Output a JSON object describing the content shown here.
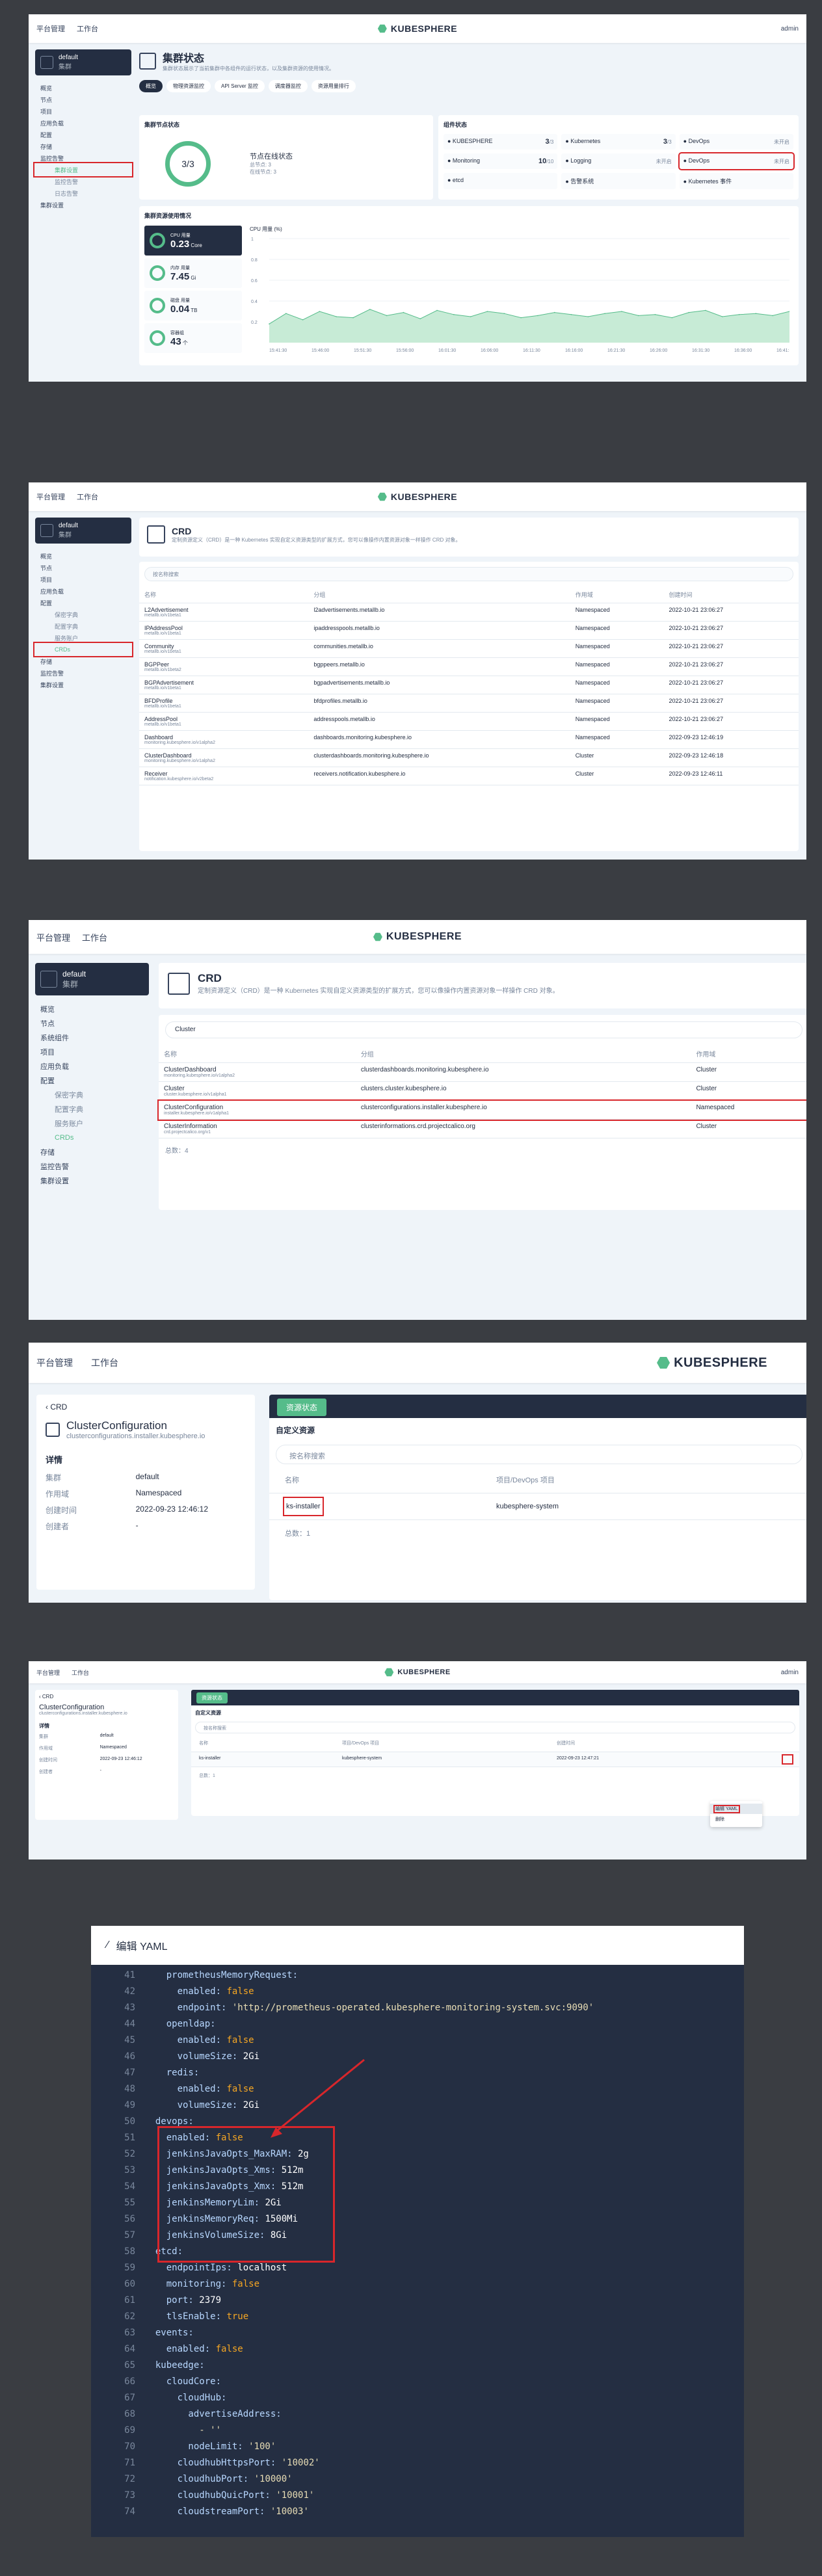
{
  "common": {
    "platform": "平台管理",
    "workbench": "工作台",
    "logo_text": "KUBESPHERE",
    "user": "admin",
    "workspace_name": "default",
    "workspace_sub": "集群"
  },
  "nav1": [
    "概览",
    "节点",
    "项目",
    "应用负载",
    "配置",
    "存储",
    "监控告警",
    "集群设置"
  ],
  "nav1_sub": [
    "集群设置",
    "监控告警",
    "日志告警"
  ],
  "s1": {
    "title": "集群状态",
    "desc": "集群状态展示了当前集群中各组件的运行状态，以及集群资源的使用情况。",
    "tabs": [
      "概览",
      "物理资源监控",
      "API Server 监控",
      "调度器监控",
      "资源用量排行"
    ],
    "node_card_title": "集群节点状态",
    "node_ring": "3/3",
    "node_status": "节点在线状态",
    "node_line1": "总节点: 3",
    "node_line2": "在线节点: 3",
    "comp_title": "组件状态",
    "components": [
      {
        "name": "KUBESPHERE",
        "count": "3",
        "unit": "/3"
      },
      {
        "name": "Kubernetes",
        "count": "3",
        "unit": "/3"
      },
      {
        "name": "DevOps",
        "count": "",
        "unit": "未开启"
      },
      {
        "name": "Monitoring",
        "count": "10",
        "unit": "/10"
      },
      {
        "name": "Logging",
        "count": "",
        "unit": "未开启"
      },
      {
        "name": "DevOps",
        "count": "",
        "unit": "未开启"
      },
      {
        "name": "etcd",
        "count": "",
        "unit": ""
      },
      {
        "name": "告警系统",
        "count": "",
        "unit": ""
      },
      {
        "name": "Kubernetes 事件",
        "count": "",
        "unit": ""
      }
    ],
    "res_title": "集群资源使用情况",
    "metrics": [
      {
        "label": "CPU 用量",
        "value": "0.23",
        "unit": "Core"
      },
      {
        "label": "内存 用量",
        "value": "7.45",
        "unit": "Gi"
      },
      {
        "label": "磁盘 用量",
        "value": "0.04",
        "unit": "TB"
      },
      {
        "label": "容器组",
        "value": "43",
        "unit": "个"
      }
    ],
    "chart_label": "CPU 用量 (%)",
    "chart_times": [
      "15:41:30",
      "15:46:00",
      "15:51:30",
      "15:56:00",
      "16:01:30",
      "16:06:00",
      "16:11:30",
      "16:16:00",
      "16:21:30",
      "16:26:00",
      "16:31:30",
      "16:36:00",
      "16:41:30"
    ]
  },
  "chart_data": {
    "type": "area",
    "title": "CPU 用量 (%)",
    "yticks": [
      "1",
      "0.8",
      "0.6",
      "0.4",
      "0.2"
    ],
    "ylim": [
      0,
      1
    ],
    "values": [
      0.18,
      0.28,
      0.22,
      0.3,
      0.25,
      0.24,
      0.32,
      0.26,
      0.29,
      0.23,
      0.31,
      0.27,
      0.25,
      0.3,
      0.28,
      0.24,
      0.26,
      0.29,
      0.27,
      0.25,
      0.28,
      0.3,
      0.26,
      0.27,
      0.24,
      0.29,
      0.31,
      0.25,
      0.27,
      0.28,
      0.26,
      0.3
    ]
  },
  "s2": {
    "title": "CRD",
    "desc": "定制资源定义（CRD）是一种 Kubernetes 实现自定义资源类型的扩展方式，您可以像操作内置资源对象一样操作 CRD 对象。",
    "search": "按名称搜索",
    "cols": [
      "名称",
      "分组",
      "作用域",
      "创建时间"
    ],
    "rows": [
      {
        "name": "L2Advertisement",
        "sub": "metallb.io/v1beta1",
        "group": "l2advertisements.metallb.io",
        "scope": "Namespaced",
        "time": "2022-10-21 23:06:27"
      },
      {
        "name": "IPAddressPool",
        "sub": "metallb.io/v1beta1",
        "group": "ipaddresspools.metallb.io",
        "scope": "Namespaced",
        "time": "2022-10-21 23:06:27"
      },
      {
        "name": "Community",
        "sub": "metallb.io/v1beta1",
        "group": "communities.metallb.io",
        "scope": "Namespaced",
        "time": "2022-10-21 23:06:27"
      },
      {
        "name": "BGPPeer",
        "sub": "metallb.io/v1beta2",
        "group": "bgppeers.metallb.io",
        "scope": "Namespaced",
        "time": "2022-10-21 23:06:27"
      },
      {
        "name": "BGPAdvertisement",
        "sub": "metallb.io/v1beta1",
        "group": "bgpadvertisements.metallb.io",
        "scope": "Namespaced",
        "time": "2022-10-21 23:06:27"
      },
      {
        "name": "BFDProfile",
        "sub": "metallb.io/v1beta1",
        "group": "bfdprofiles.metallb.io",
        "scope": "Namespaced",
        "time": "2022-10-21 23:06:27"
      },
      {
        "name": "AddressPool",
        "sub": "metallb.io/v1beta1",
        "group": "addresspools.metallb.io",
        "scope": "Namespaced",
        "time": "2022-10-21 23:06:27"
      },
      {
        "name": "Dashboard",
        "sub": "monitoring.kubesphere.io/v1alpha2",
        "group": "dashboards.monitoring.kubesphere.io",
        "scope": "Namespaced",
        "time": "2022-09-23 12:46:19"
      },
      {
        "name": "ClusterDashboard",
        "sub": "monitoring.kubesphere.io/v1alpha2",
        "group": "clusterdashboards.monitoring.kubesphere.io",
        "scope": "Cluster",
        "time": "2022-09-23 12:46:18"
      },
      {
        "name": "Receiver",
        "sub": "notification.kubesphere.io/v2beta2",
        "group": "receivers.notification.kubesphere.io",
        "scope": "Cluster",
        "time": "2022-09-23 12:46:11"
      }
    ],
    "nav_sub": [
      "保密字典",
      "配置字典",
      "服务账户",
      "CRDs"
    ]
  },
  "s3": {
    "title": "CRD",
    "desc": "定制资源定义（CRD）是一种 Kubernetes 实现自定义资源类型的扩展方式，您可以像操作内置资源对象一样操作 CRD 对象。",
    "search": "Cluster",
    "cols": [
      "名称",
      "分组",
      "作用域"
    ],
    "rows": [
      {
        "name": "ClusterDashboard",
        "sub": "monitoring.kubesphere.io/v1alpha2",
        "group": "clusterdashboards.monitoring.kubesphere.io",
        "scope": "Cluster"
      },
      {
        "name": "Cluster",
        "sub": "cluster.kubesphere.io/v1alpha1",
        "group": "clusters.cluster.kubesphere.io",
        "scope": "Cluster"
      },
      {
        "name": "ClusterConfiguration",
        "sub": "installer.kubesphere.io/v1alpha1",
        "group": "clusterconfigurations.installer.kubesphere.io",
        "scope": "Namespaced"
      },
      {
        "name": "ClusterInformation",
        "sub": "crd.projectcalico.org/v1",
        "group": "clusterinformations.crd.projectcalico.org",
        "scope": "Cluster"
      }
    ],
    "total": "总数：4",
    "nav": [
      "概览",
      "节点",
      "系统组件",
      "项目",
      "应用负载",
      "配置",
      "保密字典",
      "配置字典",
      "服务账户",
      "CRDs",
      "存储",
      "监控告警",
      "集群设置"
    ]
  },
  "s4": {
    "back": "CRD",
    "name": "ClusterConfiguration",
    "sub": "clusterconfigurations.installer.kubesphere.io",
    "detail_title": "详情",
    "fields": [
      {
        "k": "集群",
        "v": "default"
      },
      {
        "k": "作用域",
        "v": "Namespaced"
      },
      {
        "k": "创建时间",
        "v": "2022-09-23 12:46:12"
      },
      {
        "k": "创建者",
        "v": "-"
      }
    ],
    "tab": "资源状态",
    "section": "自定义资源",
    "search": "按名称搜索",
    "cols": [
      "名称",
      "项目/DevOps 项目"
    ],
    "row_name": "ks-installer",
    "row_ns": "kubesphere-system",
    "total": "总数：1"
  },
  "s5": {
    "col3": "创建时间",
    "row_time": "2022-09-23 12:47:21",
    "menu": [
      "编辑 YAML",
      "删除"
    ]
  },
  "yaml": {
    "title": "编辑 YAML",
    "lines": [
      {
        "n": "41",
        "t": "    prometheusMemoryRequest:"
      },
      {
        "n": "42",
        "t": "      enabled: false"
      },
      {
        "n": "43",
        "t": "      endpoint: 'http://prometheus-operated.kubesphere-monitoring-system.svc:9090'"
      },
      {
        "n": "44",
        "t": "    openldap:"
      },
      {
        "n": "45",
        "t": "      enabled: false"
      },
      {
        "n": "46",
        "t": "      volumeSize: 2Gi"
      },
      {
        "n": "47",
        "t": "    redis:"
      },
      {
        "n": "48",
        "t": "      enabled: false"
      },
      {
        "n": "49",
        "t": "      volumeSize: 2Gi"
      },
      {
        "n": "50",
        "t": "  devops:"
      },
      {
        "n": "51",
        "t": "    enabled: false"
      },
      {
        "n": "52",
        "t": "    jenkinsJavaOpts_MaxRAM: 2g"
      },
      {
        "n": "53",
        "t": "    jenkinsJavaOpts_Xms: 512m"
      },
      {
        "n": "54",
        "t": "    jenkinsJavaOpts_Xmx: 512m"
      },
      {
        "n": "55",
        "t": "    jenkinsMemoryLim: 2Gi"
      },
      {
        "n": "56",
        "t": "    jenkinsMemoryReq: 1500Mi"
      },
      {
        "n": "57",
        "t": "    jenkinsVolumeSize: 8Gi"
      },
      {
        "n": "58",
        "t": "  etcd:"
      },
      {
        "n": "59",
        "t": "    endpointIps: localhost"
      },
      {
        "n": "60",
        "t": "    monitoring: false"
      },
      {
        "n": "61",
        "t": "    port: 2379"
      },
      {
        "n": "62",
        "t": "    tlsEnable: true"
      },
      {
        "n": "63",
        "t": "  events:"
      },
      {
        "n": "64",
        "t": "    enabled: false"
      },
      {
        "n": "65",
        "t": "  kubeedge:"
      },
      {
        "n": "66",
        "t": "    cloudCore:"
      },
      {
        "n": "67",
        "t": "      cloudHub:"
      },
      {
        "n": "68",
        "t": "        advertiseAddress:"
      },
      {
        "n": "69",
        "t": "          - ''"
      },
      {
        "n": "70",
        "t": "        nodeLimit: '100'"
      },
      {
        "n": "71",
        "t": "      cloudhubHttpsPort: '10002'"
      },
      {
        "n": "72",
        "t": "      cloudhubPort: '10000'"
      },
      {
        "n": "73",
        "t": "      cloudhubQuicPort: '10001'"
      },
      {
        "n": "74",
        "t": "      cloudstreamPort: '10003'"
      }
    ]
  }
}
